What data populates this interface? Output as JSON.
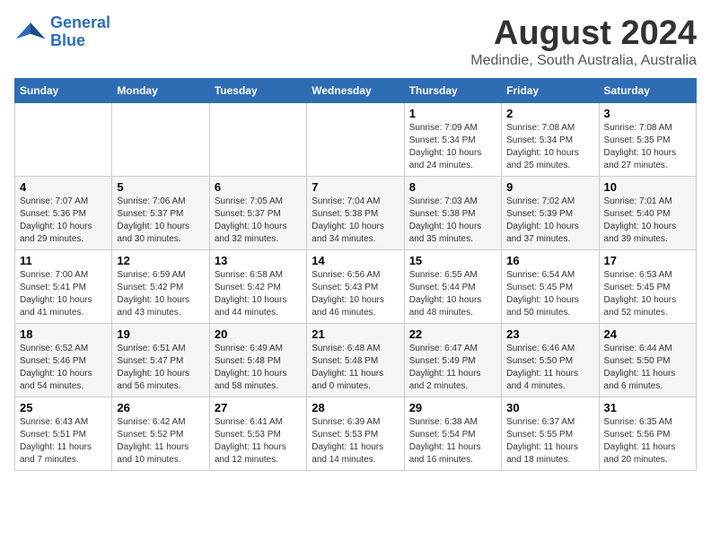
{
  "header": {
    "logo_line1": "General",
    "logo_line2": "Blue",
    "month_year": "August 2024",
    "location": "Medindie, South Australia, Australia"
  },
  "weekdays": [
    "Sunday",
    "Monday",
    "Tuesday",
    "Wednesday",
    "Thursday",
    "Friday",
    "Saturday"
  ],
  "weeks": [
    [
      {
        "day": "",
        "info": ""
      },
      {
        "day": "",
        "info": ""
      },
      {
        "day": "",
        "info": ""
      },
      {
        "day": "",
        "info": ""
      },
      {
        "day": "1",
        "info": "Sunrise: 7:09 AM\nSunset: 5:34 PM\nDaylight: 10 hours\nand 24 minutes."
      },
      {
        "day": "2",
        "info": "Sunrise: 7:08 AM\nSunset: 5:34 PM\nDaylight: 10 hours\nand 25 minutes."
      },
      {
        "day": "3",
        "info": "Sunrise: 7:08 AM\nSunset: 5:35 PM\nDaylight: 10 hours\nand 27 minutes."
      }
    ],
    [
      {
        "day": "4",
        "info": "Sunrise: 7:07 AM\nSunset: 5:36 PM\nDaylight: 10 hours\nand 29 minutes."
      },
      {
        "day": "5",
        "info": "Sunrise: 7:06 AM\nSunset: 5:37 PM\nDaylight: 10 hours\nand 30 minutes."
      },
      {
        "day": "6",
        "info": "Sunrise: 7:05 AM\nSunset: 5:37 PM\nDaylight: 10 hours\nand 32 minutes."
      },
      {
        "day": "7",
        "info": "Sunrise: 7:04 AM\nSunset: 5:38 PM\nDaylight: 10 hours\nand 34 minutes."
      },
      {
        "day": "8",
        "info": "Sunrise: 7:03 AM\nSunset: 5:38 PM\nDaylight: 10 hours\nand 35 minutes."
      },
      {
        "day": "9",
        "info": "Sunrise: 7:02 AM\nSunset: 5:39 PM\nDaylight: 10 hours\nand 37 minutes."
      },
      {
        "day": "10",
        "info": "Sunrise: 7:01 AM\nSunset: 5:40 PM\nDaylight: 10 hours\nand 39 minutes."
      }
    ],
    [
      {
        "day": "11",
        "info": "Sunrise: 7:00 AM\nSunset: 5:41 PM\nDaylight: 10 hours\nand 41 minutes."
      },
      {
        "day": "12",
        "info": "Sunrise: 6:59 AM\nSunset: 5:42 PM\nDaylight: 10 hours\nand 43 minutes."
      },
      {
        "day": "13",
        "info": "Sunrise: 6:58 AM\nSunset: 5:42 PM\nDaylight: 10 hours\nand 44 minutes."
      },
      {
        "day": "14",
        "info": "Sunrise: 6:56 AM\nSunset: 5:43 PM\nDaylight: 10 hours\nand 46 minutes."
      },
      {
        "day": "15",
        "info": "Sunrise: 6:55 AM\nSunset: 5:44 PM\nDaylight: 10 hours\nand 48 minutes."
      },
      {
        "day": "16",
        "info": "Sunrise: 6:54 AM\nSunset: 5:45 PM\nDaylight: 10 hours\nand 50 minutes."
      },
      {
        "day": "17",
        "info": "Sunrise: 6:53 AM\nSunset: 5:45 PM\nDaylight: 10 hours\nand 52 minutes."
      }
    ],
    [
      {
        "day": "18",
        "info": "Sunrise: 6:52 AM\nSunset: 5:46 PM\nDaylight: 10 hours\nand 54 minutes."
      },
      {
        "day": "19",
        "info": "Sunrise: 6:51 AM\nSunset: 5:47 PM\nDaylight: 10 hours\nand 56 minutes."
      },
      {
        "day": "20",
        "info": "Sunrise: 6:49 AM\nSunset: 5:48 PM\nDaylight: 10 hours\nand 58 minutes."
      },
      {
        "day": "21",
        "info": "Sunrise: 6:48 AM\nSunset: 5:48 PM\nDaylight: 11 hours\nand 0 minutes."
      },
      {
        "day": "22",
        "info": "Sunrise: 6:47 AM\nSunset: 5:49 PM\nDaylight: 11 hours\nand 2 minutes."
      },
      {
        "day": "23",
        "info": "Sunrise: 6:46 AM\nSunset: 5:50 PM\nDaylight: 11 hours\nand 4 minutes."
      },
      {
        "day": "24",
        "info": "Sunrise: 6:44 AM\nSunset: 5:50 PM\nDaylight: 11 hours\nand 6 minutes."
      }
    ],
    [
      {
        "day": "25",
        "info": "Sunrise: 6:43 AM\nSunset: 5:51 PM\nDaylight: 11 hours\nand 7 minutes."
      },
      {
        "day": "26",
        "info": "Sunrise: 6:42 AM\nSunset: 5:52 PM\nDaylight: 11 hours\nand 10 minutes."
      },
      {
        "day": "27",
        "info": "Sunrise: 6:41 AM\nSunset: 5:53 PM\nDaylight: 11 hours\nand 12 minutes."
      },
      {
        "day": "28",
        "info": "Sunrise: 6:39 AM\nSunset: 5:53 PM\nDaylight: 11 hours\nand 14 minutes."
      },
      {
        "day": "29",
        "info": "Sunrise: 6:38 AM\nSunset: 5:54 PM\nDaylight: 11 hours\nand 16 minutes."
      },
      {
        "day": "30",
        "info": "Sunrise: 6:37 AM\nSunset: 5:55 PM\nDaylight: 11 hours\nand 18 minutes."
      },
      {
        "day": "31",
        "info": "Sunrise: 6:35 AM\nSunset: 5:56 PM\nDaylight: 11 hours\nand 20 minutes."
      }
    ]
  ]
}
